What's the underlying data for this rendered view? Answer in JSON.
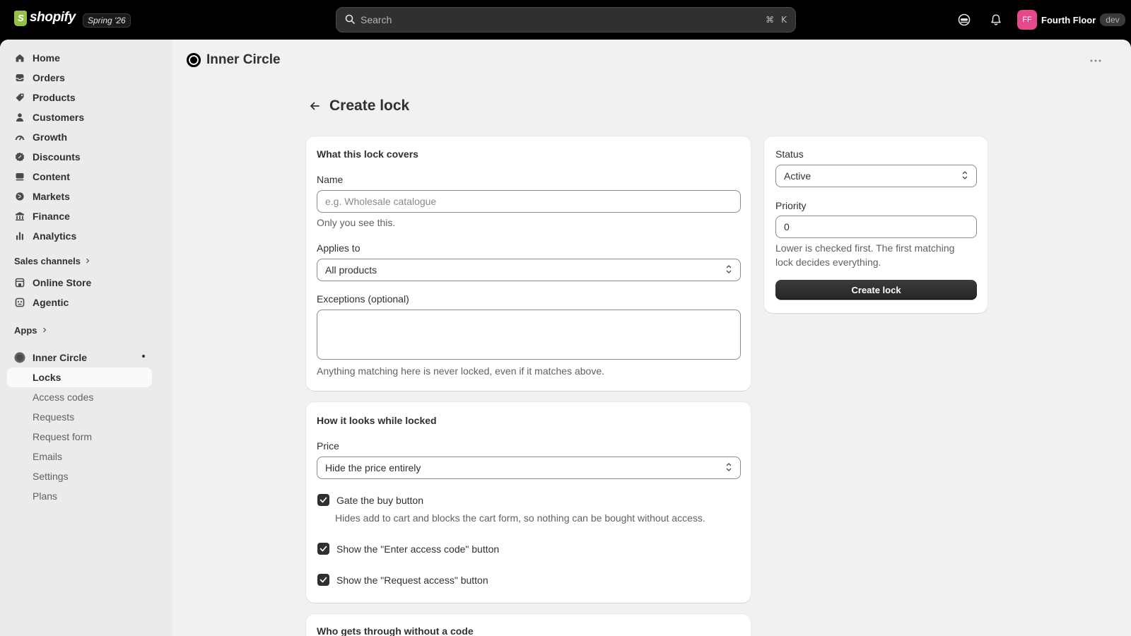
{
  "topbar": {
    "logo_text": "shopify",
    "release_badge": "Spring '26",
    "search_placeholder": "Search",
    "shortcut_cmd": "⌘",
    "shortcut_key": "K",
    "avatar_initials": "FF",
    "store_name": "Fourth Floor",
    "env_badge": "dev"
  },
  "sidebar": {
    "main_items": [
      {
        "label": "Home",
        "icon": "home-icon"
      },
      {
        "label": "Orders",
        "icon": "inbox-icon"
      },
      {
        "label": "Products",
        "icon": "tag-icon"
      },
      {
        "label": "Customers",
        "icon": "person-icon"
      },
      {
        "label": "Growth",
        "icon": "gauge-icon"
      },
      {
        "label": "Discounts",
        "icon": "discount-icon"
      },
      {
        "label": "Content",
        "icon": "content-icon"
      },
      {
        "label": "Markets",
        "icon": "globe-icon"
      },
      {
        "label": "Finance",
        "icon": "bank-icon"
      },
      {
        "label": "Analytics",
        "icon": "bar-chart-icon"
      }
    ],
    "sales_channels_label": "Sales channels",
    "channels": [
      {
        "label": "Online Store",
        "icon": "store-icon"
      },
      {
        "label": "Agentic",
        "icon": "robot-icon"
      }
    ],
    "apps_label": "Apps",
    "app": {
      "label": "Inner Circle",
      "sub_items": [
        "Locks",
        "Access codes",
        "Requests",
        "Request form",
        "Emails",
        "Settings",
        "Plans"
      ],
      "active": "Locks"
    }
  },
  "header": {
    "app_title": "Inner Circle",
    "page_title": "Create lock"
  },
  "covers_card": {
    "title": "What this lock covers",
    "name_label": "Name",
    "name_placeholder": "e.g. Wholesale catalogue",
    "name_help": "Only you see this.",
    "applies_label": "Applies to",
    "applies_value": "All products",
    "exceptions_label": "Exceptions (optional)",
    "exceptions_help": "Anything matching here is never locked, even if it matches above."
  },
  "looks_card": {
    "title": "How it looks while locked",
    "price_label": "Price",
    "price_value": "Hide the price entirely",
    "gate_label": "Gate the buy button",
    "gate_help": "Hides add to cart and blocks the cart form, so nothing can be bought without access.",
    "gate_checked": true,
    "access_code_label": "Show the \"Enter access code\" button",
    "access_code_checked": true,
    "request_label": "Show the \"Request access\" button",
    "request_checked": true
  },
  "who_card": {
    "title": "Who gets through without a code"
  },
  "side_card": {
    "status_label": "Status",
    "status_value": "Active",
    "priority_label": "Priority",
    "priority_value": "0",
    "priority_help": "Lower is checked first. The first matching lock decides everything.",
    "create_button": "Create lock"
  }
}
